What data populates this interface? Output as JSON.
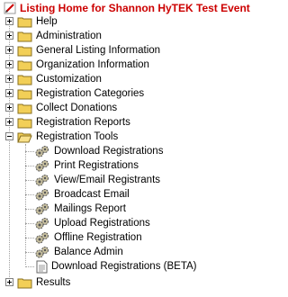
{
  "header": {
    "title": "Listing Home for Shannon HyTEK Test Event"
  },
  "tree": {
    "items": [
      {
        "label": "Help",
        "expander": "plus"
      },
      {
        "label": "Administration",
        "expander": "plus"
      },
      {
        "label": "General Listing Information",
        "expander": "plus"
      },
      {
        "label": "Organization Information",
        "expander": "plus"
      },
      {
        "label": "Customization",
        "expander": "plus"
      },
      {
        "label": "Registration Categories",
        "expander": "plus"
      },
      {
        "label": "Collect Donations",
        "expander": "plus"
      },
      {
        "label": "Registration Reports",
        "expander": "plus"
      },
      {
        "label": "Registration Tools",
        "expander": "minus",
        "children": [
          {
            "label": "Download Registrations",
            "icon": "gear-icon"
          },
          {
            "label": "Print Registrations",
            "icon": "gear-icon"
          },
          {
            "label": "View/Email Registrants",
            "icon": "gear-icon"
          },
          {
            "label": "Broadcast Email",
            "icon": "gear-icon"
          },
          {
            "label": "Mailings Report",
            "icon": "gear-icon"
          },
          {
            "label": "Upload Registrations",
            "icon": "gear-icon"
          },
          {
            "label": "Offline Registration",
            "icon": "gear-icon"
          },
          {
            "label": "Balance Admin",
            "icon": "gear-icon"
          },
          {
            "label": "Download Registrations (BETA)",
            "icon": "document-icon"
          }
        ]
      },
      {
        "label": "Results",
        "expander": "plus"
      }
    ]
  },
  "colors": {
    "title": "#cc0000",
    "folder": "#f2cf57",
    "tree_line": "#a0a0a0"
  }
}
